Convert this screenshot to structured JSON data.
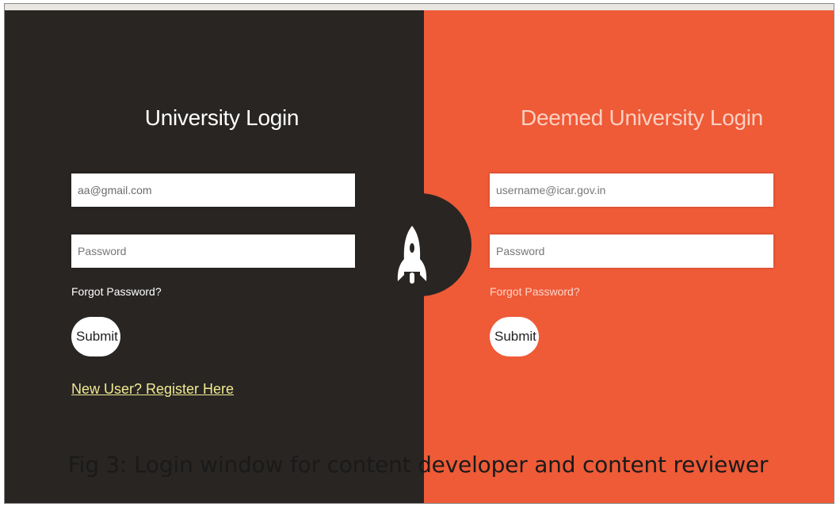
{
  "university": {
    "title": "University Login",
    "email_value": "aa@gmail.com",
    "password_placeholder": "Password",
    "forgot_label": "Forgot Password?",
    "submit_label": "Submit",
    "register_label": "New User? Register Here"
  },
  "deemed": {
    "title": "Deemed University Login",
    "email_placeholder": "username@icar.gov.in",
    "password_placeholder": "Password",
    "forgot_label": "Forgot Password?",
    "submit_label": "Submit"
  },
  "center_icon": "rocket-icon",
  "caption": "Fig 3: Login window for content  developer and content reviewer",
  "colors": {
    "left_panel": "#282523",
    "right_panel": "#ef5a37",
    "register_link": "#f1ea92"
  }
}
